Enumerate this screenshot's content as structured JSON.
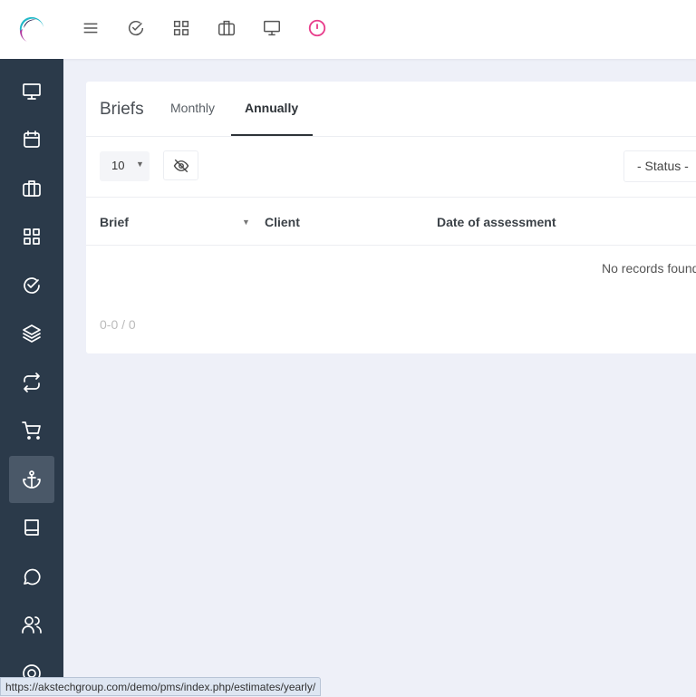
{
  "topbar": {
    "icons": [
      "menu-icon",
      "check-circle-icon",
      "grid-icon",
      "briefcase-icon",
      "monitor-icon",
      "alert-circle-icon"
    ],
    "alert_color": "#e83e8c"
  },
  "sidebar": {
    "items": [
      "monitor-icon",
      "calendar-icon",
      "briefcase-icon",
      "grid-icon",
      "check-circle-icon",
      "layers-icon",
      "repeat-icon",
      "cart-icon",
      "anchor-icon",
      "book-icon",
      "message-icon",
      "users-icon",
      "lifebuoy-icon"
    ],
    "active": "anchor-icon",
    "bg": "#2b3a4a"
  },
  "card": {
    "title": "Briefs",
    "tabs": [
      {
        "label": "Monthly",
        "active": false
      },
      {
        "label": "Annually",
        "active": true
      }
    ],
    "page_size": "10",
    "status_filter": "- Status -",
    "columns": [
      "Brief",
      "Client",
      "Date of assessment"
    ],
    "empty": "No records found",
    "count": "0-0 / 0"
  },
  "status_url": "https://akstechgroup.com/demo/pms/index.php/estimates/yearly/"
}
